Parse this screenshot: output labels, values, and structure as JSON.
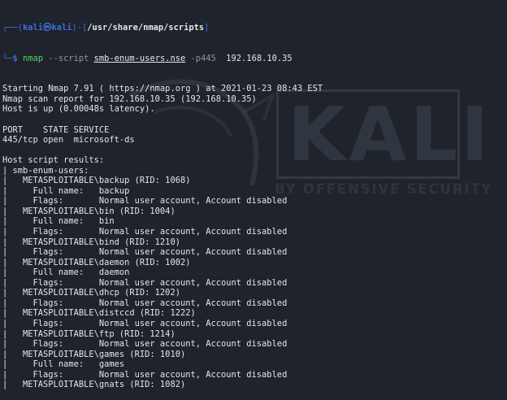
{
  "watermark": {
    "logo_text": "KALI",
    "tagline": "BY OFFENSIVE SECURITY"
  },
  "prompt": {
    "open_frame": "┌──(",
    "user": "kali",
    "at_symbol": "㉿",
    "host": "kali",
    "mid_frame": ")-[",
    "path": "/usr/share/nmap/scripts",
    "close_frame": "]",
    "second_frame": "└─",
    "dollar": "$ ",
    "cmd": "nmap",
    "opt1": " --script ",
    "script_name": "smb-enum-users.nse",
    "opt2": " -p445 ",
    "target": " 192.168.10.35"
  },
  "output_lines": [
    "Starting Nmap 7.91 ( https://nmap.org ) at 2021-01-23 08:43 EST",
    "Nmap scan report for 192.168.10.35 (192.168.10.35)",
    "Host is up (0.00048s latency).",
    "",
    "PORT    STATE SERVICE",
    "445/tcp open  microsoft-ds",
    "",
    "Host script results:",
    "| smb-enum-users:",
    "|   METASPLOITABLE\\backup (RID: 1068)",
    "|     Full name:   backup",
    "|     Flags:       Normal user account, Account disabled",
    "|   METASPLOITABLE\\bin (RID: 1004)",
    "|     Full name:   bin",
    "|     Flags:       Normal user account, Account disabled",
    "|   METASPLOITABLE\\bind (RID: 1210)",
    "|     Flags:       Normal user account, Account disabled",
    "|   METASPLOITABLE\\daemon (RID: 1002)",
    "|     Full name:   daemon",
    "|     Flags:       Normal user account, Account disabled",
    "|   METASPLOITABLE\\dhcp (RID: 1202)",
    "|     Flags:       Normal user account, Account disabled",
    "|   METASPLOITABLE\\distccd (RID: 1222)",
    "|     Flags:       Normal user account, Account disabled",
    "|   METASPLOITABLE\\ftp (RID: 1214)",
    "|     Flags:       Normal user account, Account disabled",
    "|   METASPLOITABLE\\games (RID: 1010)",
    "|     Full name:   games",
    "|     Flags:       Normal user account, Account disabled",
    "|   METASPLOITABLE\\gnats (RID: 1082)"
  ]
}
